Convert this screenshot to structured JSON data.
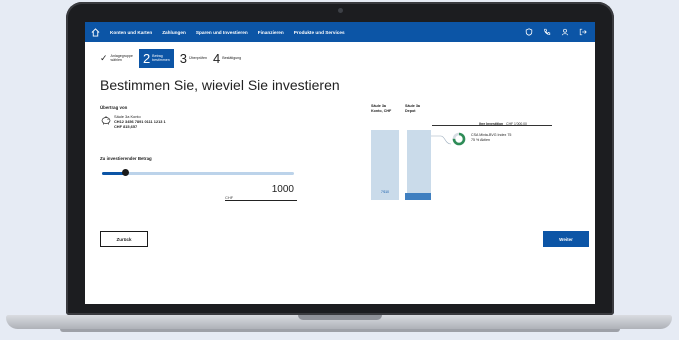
{
  "nav": {
    "items": [
      "Konten und Karten",
      "Zahlungen",
      "Sparen und Investieren",
      "Finanzieren",
      "Produkte und Services"
    ]
  },
  "stepper": {
    "step1": {
      "label1": "Anlagegruppe",
      "label2": "wählen"
    },
    "step2": {
      "num": "2",
      "label1": "Betrag",
      "label2": "bestimmen"
    },
    "step3": {
      "num": "3",
      "label": "Überprüfen"
    },
    "step4": {
      "num": "4",
      "label": "Bestätigung"
    }
  },
  "page_title": "Bestimmen Sie, wieviel Sie investieren",
  "transfer": {
    "heading": "Übertrag von",
    "account_type": "Säule 3a Konto",
    "iban": "CH12 3456 7891 0111 1213 1",
    "balance": "CHF 815,657"
  },
  "amount": {
    "heading": "Zu investierender Betrag",
    "unit": "CHF",
    "value": "1000",
    "slider_fraction": 0.12
  },
  "buttons": {
    "back": "Zurück",
    "next": "Weiter"
  },
  "viz": {
    "col1_line1": "Säule 3a",
    "col1_line2": "Konto, CHF",
    "col2_line1": "Säule 3a",
    "col2_line2": "Depot",
    "bar_label": "7'610",
    "invest_label": "Ihre Investition",
    "invest_amount": "CHF 1'000.00",
    "fund_name": "CSA Mixta-BVG Index 75",
    "fund_share": "75 % Aktien"
  },
  "colors": {
    "brand": "#0c55a6",
    "bar_light": "#cadbea",
    "bar_dark": "#3f7fc0"
  }
}
